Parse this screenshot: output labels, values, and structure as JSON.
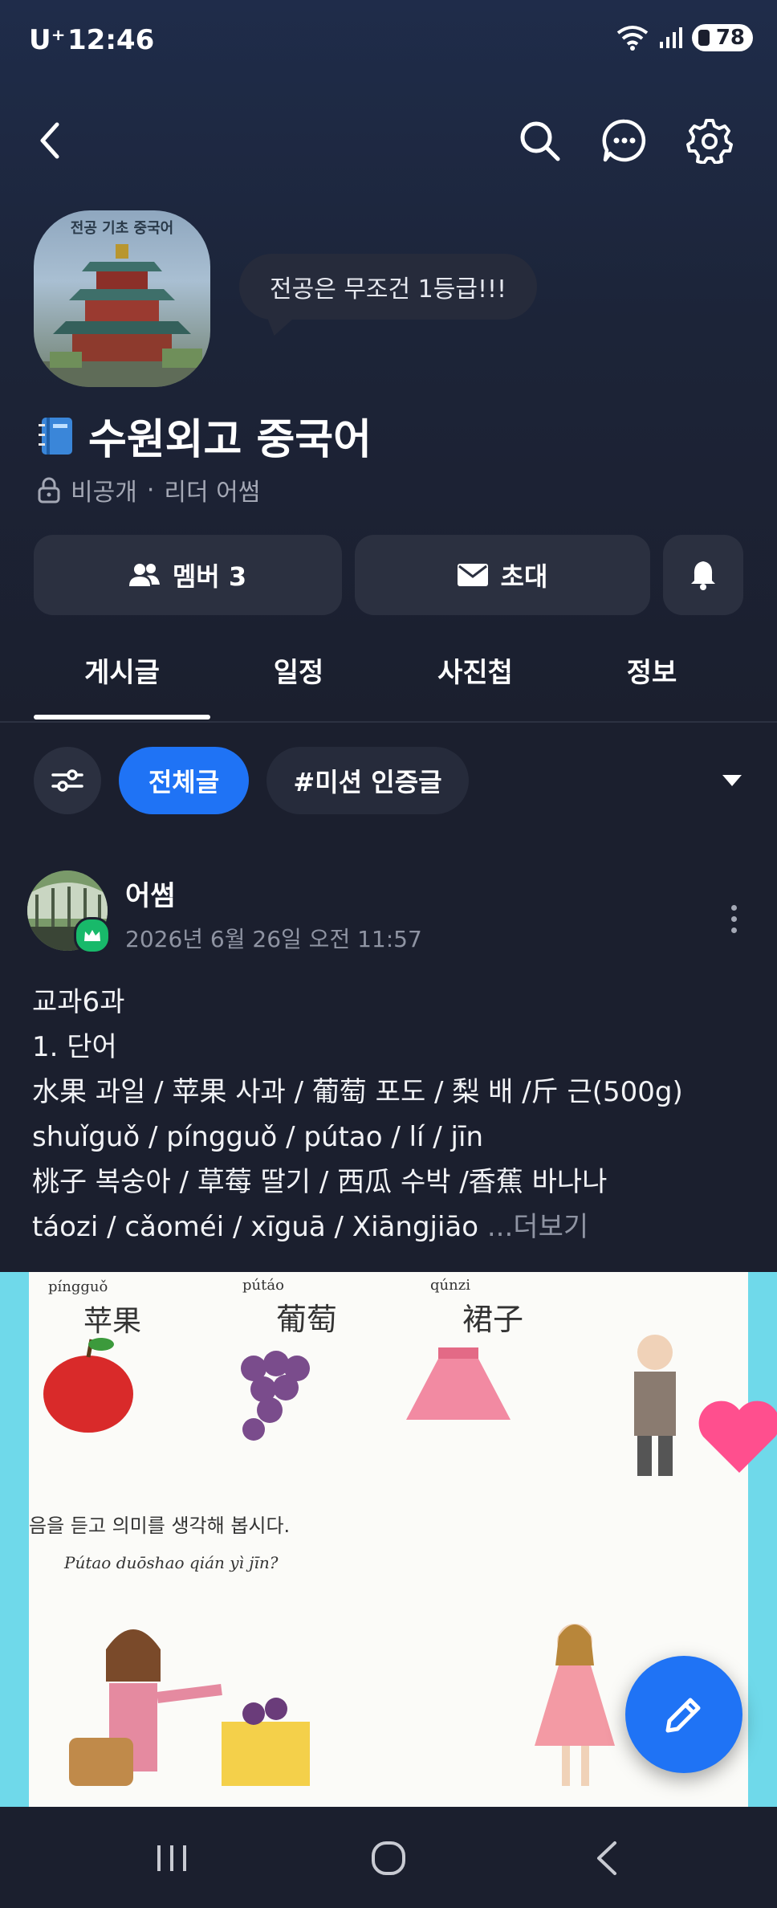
{
  "status_bar": {
    "carrier": "U⁺",
    "time": "12:46",
    "battery": "78",
    "icons": [
      "wifi-icon",
      "signal-icon",
      "battery-icon"
    ]
  },
  "app_bar": {
    "icons": [
      "back-icon",
      "search-icon",
      "chat-icon",
      "settings-icon"
    ]
  },
  "club": {
    "cover_title": "전공 기초 중국어",
    "speech_bubble": "전공은 무조건 1등급!!!",
    "name": "수원외고 중국어",
    "name_icon": "notebook-icon",
    "privacy": "비공개",
    "separator": "·",
    "leader": "리더 어썸"
  },
  "actions": {
    "members": "멤버 3",
    "invite": "초대",
    "notify_icon": "bell-icon"
  },
  "tabs": [
    "게시글",
    "일정",
    "사진첩",
    "정보"
  ],
  "filters": {
    "all": "전체글",
    "mission": "#미션 인증글"
  },
  "post": {
    "author": "어썸",
    "date": "2026년 6월 26일 오전 11:57",
    "lines": [
      "교과6과",
      "1. 단어",
      "水果 과일 / 苹果 사과 /  葡萄 포도 / 梨 배 /斤 근(500g)",
      "shuǐguǒ  / píngguǒ  /   pútao     /  lí      / jīn",
      "桃子 복숭아 / 草莓 딸기 /  西瓜 수박 /香蕉 바나나",
      "táozi          / cǎoméi   /  xīguā       / Xiāngjiāo "
    ],
    "more": "...더보기",
    "image_texts": {
      "pinyin1": "píngguǒ",
      "hanzi1": "苹果",
      "pinyin2": "pútáo",
      "hanzi2": "葡萄",
      "pinyin3": "qúnzi",
      "hanzi3": "裙子",
      "instruction": "음을 듣고 의미를 생각해 봅시다.",
      "sentence": "Pútao duōshao qián yì jīn?"
    }
  },
  "colors": {
    "accent": "#1f73f5",
    "background": "#1b1f2e",
    "card": "#2b3040",
    "leader_badge": "#18b96a"
  }
}
